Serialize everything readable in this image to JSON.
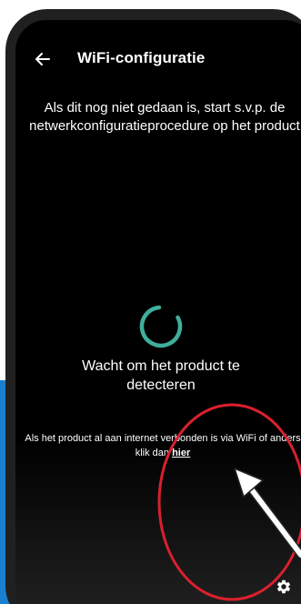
{
  "header": {
    "back_icon": "arrow-left-icon",
    "title": "WiFi-configuratie"
  },
  "main": {
    "instruction": "Als dit nog niet gedaan is, start s.v.p. de netwerkconfiguratieprocedure op het product",
    "spinner_icon": "loading-spinner-icon",
    "waiting_text": "Wacht om het product te detecteren",
    "connected_note_prefix": "Als het product al aan internet verbonden is via WiFi of anders klik dan",
    "connected_note_link": "hier"
  },
  "footer": {
    "settings_icon": "gear-icon"
  },
  "colors": {
    "screen_background": "#000000",
    "text": "#ffffff",
    "spinner": "#3fae9a",
    "highlight_circle": "#d9202e",
    "arrow": "#ffffff",
    "side_panel": "#1b7fd0"
  }
}
